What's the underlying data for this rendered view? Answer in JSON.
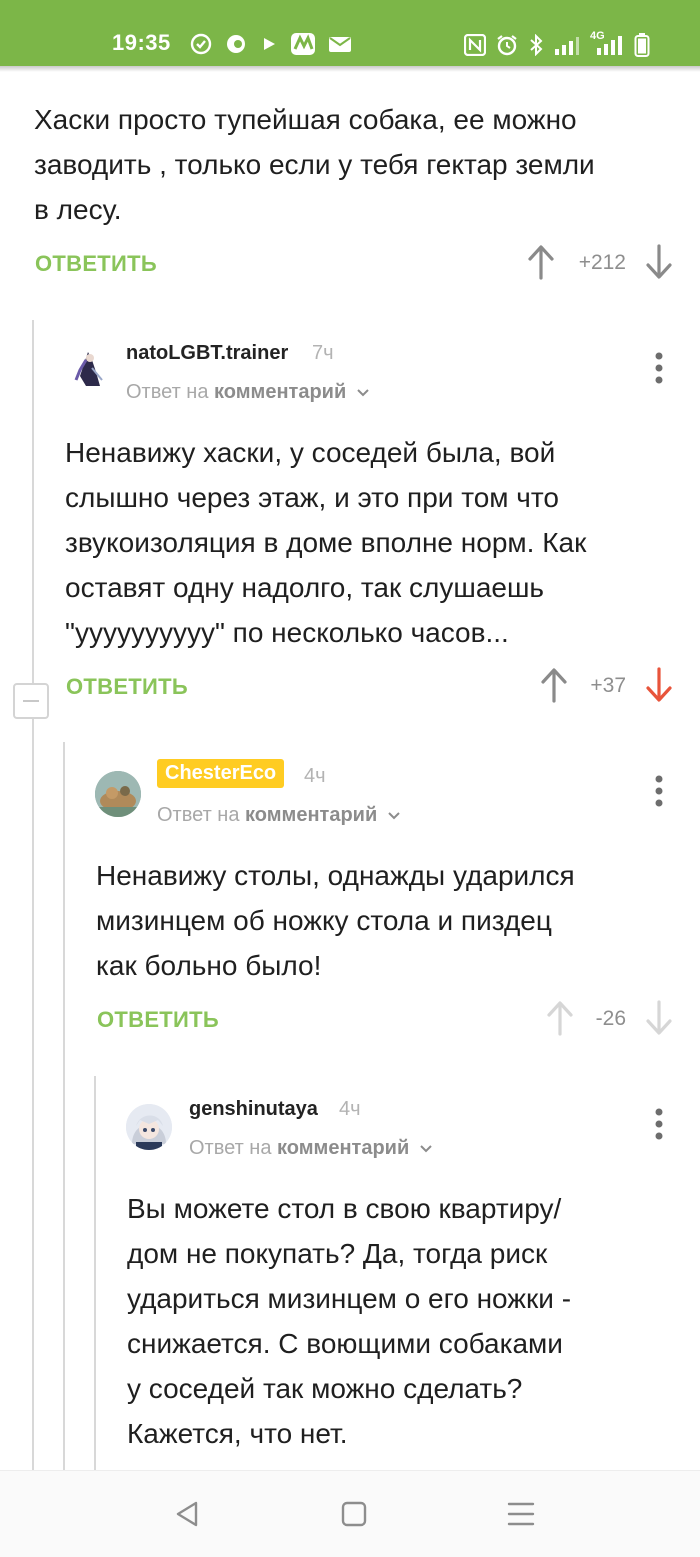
{
  "status_bar": {
    "time": "19:35",
    "network": "4G",
    "left_icons": [
      "sync-icon",
      "record-icon",
      "play-icon",
      "app-icon",
      "mail-icon"
    ],
    "right_icons": [
      "nfc-icon",
      "alarm-icon",
      "bluetooth-icon",
      "signal-icon",
      "signal-4g-icon",
      "battery-icon"
    ]
  },
  "comments": [
    {
      "text": "Хаски просто тупейшая собака, ее можно\nзаводить , только если у тебя гектар земли\nв лесу.",
      "reply_label": "ОТВЕТИТЬ",
      "score": "+212"
    },
    {
      "author": "natoLGBT.trainer",
      "time": "7ч",
      "reply_to_prefix": "Ответ на",
      "reply_to_link": "комментарий",
      "text": "Ненавижу хаски, у соседей была, вой\nслышно через этаж, и это при том что\nзвукоизоляция в доме вполне норм. Как\nоставят одну надолго, так слушаешь\n\"уууууууууу\" по несколько часов...",
      "reply_label": "ОТВЕТИТЬ",
      "score": "+37",
      "vote": "down"
    },
    {
      "author": "ChesterEco",
      "time": "4ч",
      "reply_to_prefix": "Ответ на",
      "reply_to_link": "комментарий",
      "text": "Ненавижу столы, однажды ударился\nмизинцем об ножку стола и пиздец\nкак больно было!",
      "reply_label": "ОТВЕТИТЬ",
      "score": "-26"
    },
    {
      "author": "genshinutaya",
      "time": "4ч",
      "reply_to_prefix": "Ответ на",
      "reply_to_link": "комментарий",
      "text": "Вы можете стол в свою квартиру/\nдом не покупать? Да, тогда риск\nудариться мизинцем о его ножки -\nснижается. С воющими собаками\nу соседей так можно сделать?\nКажется, что нет."
    }
  ],
  "colors": {
    "status_bar": "#7cb648",
    "reply": "#8ac45a",
    "downvote_active": "#e8543b",
    "badge": "#ffcc22"
  },
  "navigation": [
    "back-icon",
    "home-icon",
    "menu-icon"
  ]
}
